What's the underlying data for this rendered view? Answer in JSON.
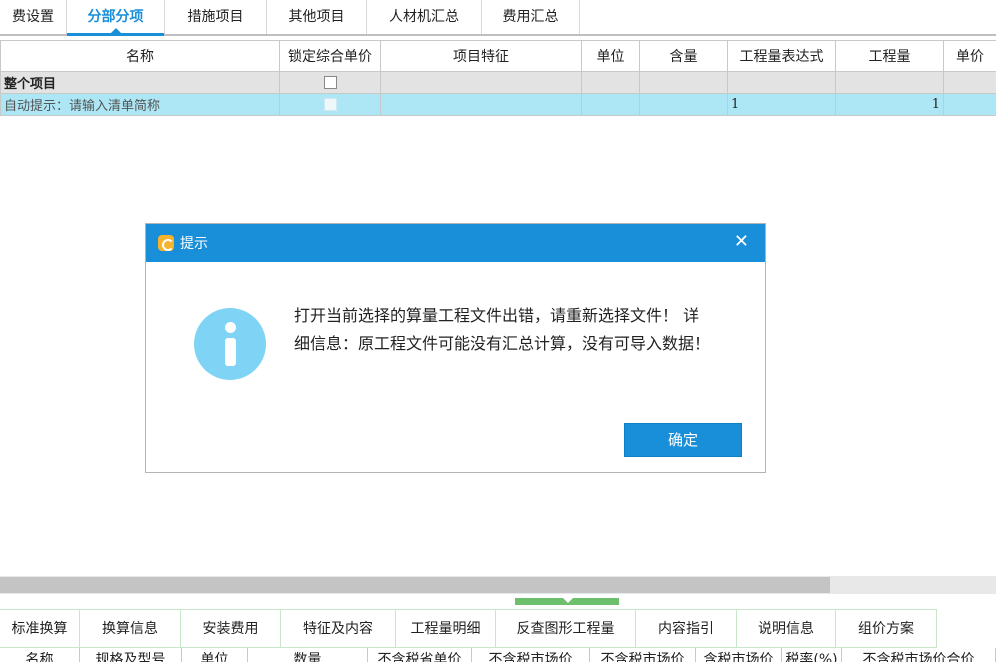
{
  "top_tabs": [
    {
      "label": "费设置",
      "active": false
    },
    {
      "label": "分部分项",
      "active": true
    },
    {
      "label": "措施项目",
      "active": false
    },
    {
      "label": "其他项目",
      "active": false
    },
    {
      "label": "人材机汇总",
      "active": false
    },
    {
      "label": "费用汇总",
      "active": false
    }
  ],
  "grid": {
    "columns": [
      "名称",
      "锁定综合单价",
      "项目特征",
      "单位",
      "含量",
      "工程量表达式",
      "工程量",
      "单价"
    ],
    "rows": [
      {
        "name": "整个项目",
        "locked": false,
        "feature": "",
        "unit": "",
        "content": "",
        "expr": "",
        "qty": "",
        "price": ""
      },
      {
        "name": "自动提示：请输入清单简称",
        "locked": false,
        "feature": "",
        "unit": "",
        "content": "",
        "expr": "1",
        "qty": "1",
        "price": ""
      }
    ]
  },
  "dialog": {
    "title": "提示",
    "close": "✕",
    "message": "打开当前选择的算量工程文件出错，请重新选择文件！ 详细信息：原工程文件可能没有汇总计算，没有可导入数据！",
    "ok_label": "确定",
    "colors": {
      "title_bar": "#1a8fd9",
      "info_icon": "#7fd3f5",
      "button": "#1a8fd9"
    }
  },
  "bottom_tabs": [
    "标准换算",
    "换算信息",
    "安装费用",
    "特征及内容",
    "工程量明细",
    "反查图形工程量",
    "内容指引",
    "说明信息",
    "组价方案"
  ],
  "bottom_columns": [
    "名称",
    "规格及型号",
    "单位",
    "数量",
    "不含税省单价",
    "不含税市场价",
    "不含税市场价",
    "含税市场价",
    "税率(%)",
    "不含税市场价合价"
  ]
}
